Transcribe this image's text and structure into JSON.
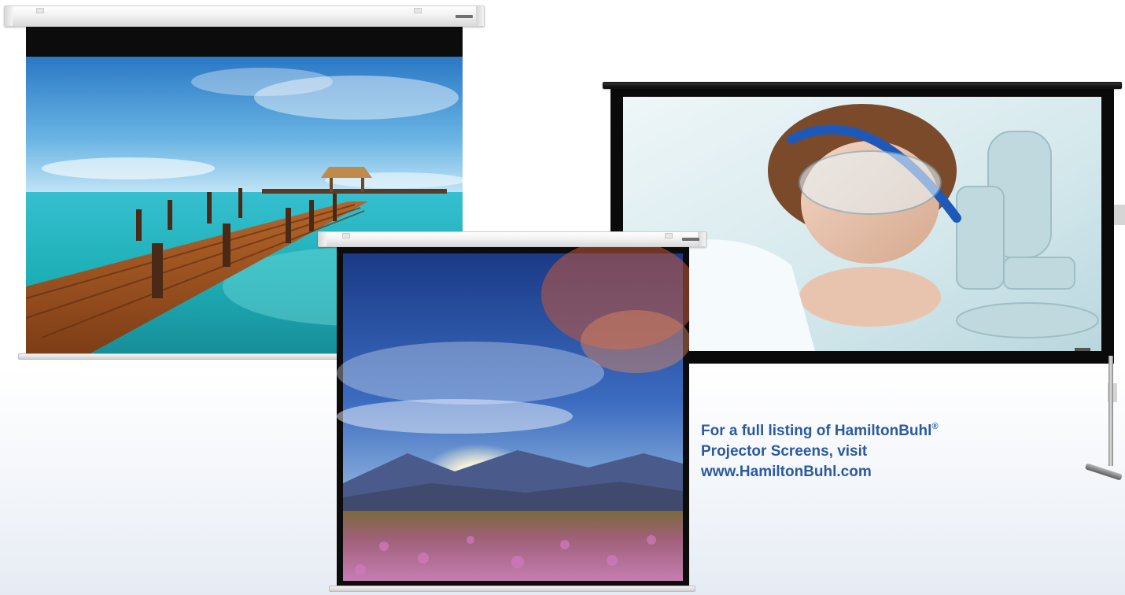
{
  "caption": {
    "line1_pre": "For a full listing of HamiltonBuhl",
    "line1_mark": "®",
    "line2": "Projector Screens, visit",
    "line3": "www.HamiltonBuhl.com"
  },
  "screens": [
    {
      "name": "wall-screen-pier",
      "content": "pier-beach-image"
    },
    {
      "name": "pull-down-screen-mountains",
      "content": "mountain-sunset-image"
    },
    {
      "name": "portable-screen-lab",
      "content": "scientist-microscope-image"
    }
  ],
  "colors": {
    "caption_text": "#2a5aa0",
    "frame_black": "#0c0c0c"
  }
}
